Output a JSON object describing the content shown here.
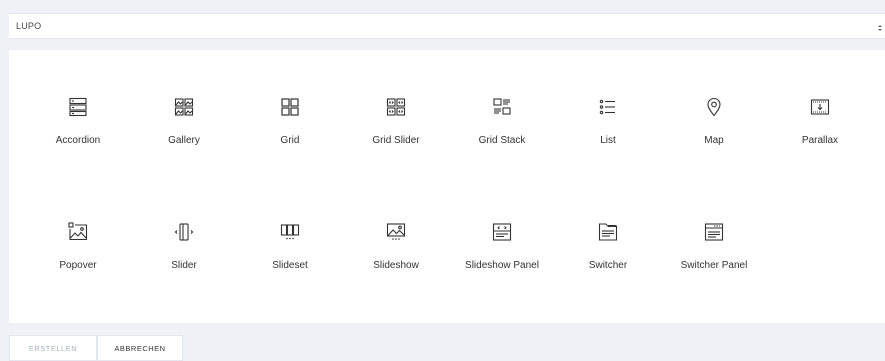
{
  "library_select": {
    "value": "LUPO"
  },
  "elements": [
    {
      "label": "Accordion",
      "icon": "accordion-icon"
    },
    {
      "label": "Gallery",
      "icon": "gallery-icon"
    },
    {
      "label": "Grid",
      "icon": "grid-icon"
    },
    {
      "label": "Grid Slider",
      "icon": "grid-slider-icon"
    },
    {
      "label": "Grid Stack",
      "icon": "grid-stack-icon"
    },
    {
      "label": "List",
      "icon": "list-icon"
    },
    {
      "label": "Map",
      "icon": "map-pin-icon"
    },
    {
      "label": "Parallax",
      "icon": "parallax-icon"
    },
    {
      "label": "Popover",
      "icon": "popover-icon"
    },
    {
      "label": "Slider",
      "icon": "slider-icon"
    },
    {
      "label": "Slideset",
      "icon": "slideset-icon"
    },
    {
      "label": "Slideshow",
      "icon": "slideshow-icon"
    },
    {
      "label": "Slideshow Panel",
      "icon": "slideshow-panel-icon"
    },
    {
      "label": "Switcher",
      "icon": "switcher-icon"
    },
    {
      "label": "Switcher Panel",
      "icon": "switcher-panel-icon"
    }
  ],
  "footer": {
    "create_label": "ERSTELLEN",
    "cancel_label": "ABBRECHEN"
  },
  "colors": {
    "background": "#eef1f6",
    "panel": "#ffffff",
    "icon_stroke": "#333333",
    "disabled_text": "#aab0ba"
  }
}
